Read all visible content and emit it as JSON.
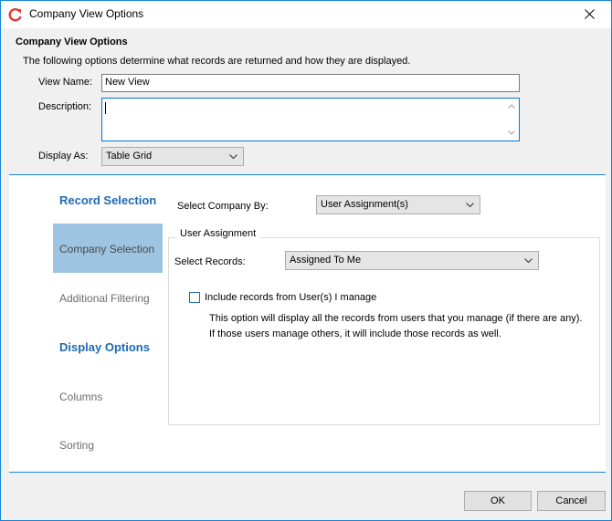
{
  "window": {
    "title": "Company View Options",
    "close_icon": "close-icon",
    "app_icon": "refresh-arrow-icon",
    "border_color": "#1883d7"
  },
  "header": {
    "title": "Company View Options",
    "description": "The following options determine what records are returned and how they are displayed."
  },
  "form": {
    "view_name_label": "View Name:",
    "view_name_value": "New View",
    "description_label": "Description:",
    "description_value": "",
    "display_as_label": "Display As:",
    "display_as_value": "Table Grid"
  },
  "nav": {
    "record_selection_heading": "Record Selection",
    "company_selection": "Company Selection",
    "additional_filtering": "Additional Filtering",
    "display_options_heading": "Display Options",
    "columns": "Columns",
    "sorting": "Sorting",
    "selected_bg": "#9dc4e0",
    "heading_color": "#1e6ab4"
  },
  "company_selection": {
    "select_company_by_label": "Select Company By:",
    "select_company_by_value": "User Assignment(s)",
    "group_title": "User Assignment",
    "select_records_label": "Select Records:",
    "select_records_value": "Assigned To Me",
    "include_checkbox_label": "Include records from User(s) I manage",
    "include_checked": false,
    "info_text": "This option will display all the records from users that you manage (if there are any). If those users manage others, it will include those records as well."
  },
  "footer": {
    "ok_label": "OK",
    "cancel_label": "Cancel"
  }
}
